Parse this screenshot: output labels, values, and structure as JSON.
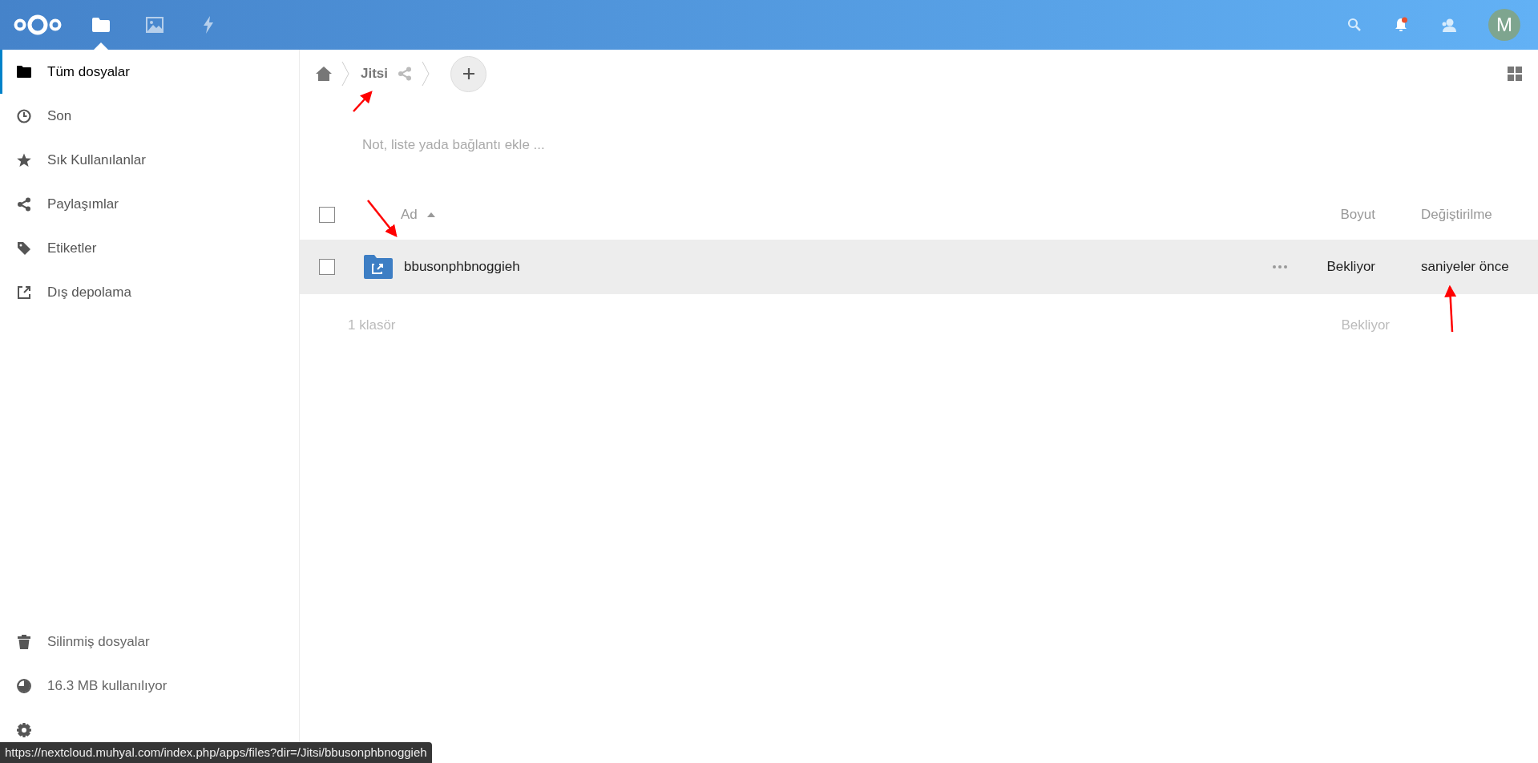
{
  "header": {
    "apps": [
      {
        "kind": "files",
        "selected": true
      },
      {
        "kind": "gallery",
        "selected": false
      },
      {
        "kind": "activity",
        "selected": false
      }
    ],
    "notifications_unread": true,
    "avatar": "M"
  },
  "sidebar": {
    "items": [
      {
        "kind": "folder",
        "label": "Tüm dosyalar",
        "selected": true
      },
      {
        "kind": "clock",
        "label": "Son",
        "selected": false
      },
      {
        "kind": "star",
        "label": "Sık Kullanılanlar",
        "selected": false
      },
      {
        "kind": "share",
        "label": "Paylaşımlar",
        "selected": false
      },
      {
        "kind": "tag",
        "label": "Etiketler",
        "selected": false
      },
      {
        "kind": "external",
        "label": "Dış depolama",
        "selected": false
      }
    ],
    "bottom_items": [
      {
        "kind": "trash",
        "label": "Silinmiş dosyalar"
      },
      {
        "kind": "quota",
        "label": "16.3 MB kullanılıyor"
      },
      {
        "kind": "settings"
      }
    ]
  },
  "breadcrumb": {
    "folder": "Jitsi"
  },
  "note": {
    "placeholder": "Not, liste yada bağlantı ekle ..."
  },
  "table": {
    "select_all": {
      "checked": false
    },
    "columns": [
      "Ad",
      "Boyut",
      "Değiştirilme"
    ],
    "rows": [
      {
        "name": "bbusonphbnoggieh",
        "size": "Bekliyor",
        "modified": "saniyeler önce",
        "checked": false,
        "highlighted": true
      }
    ],
    "footer": {
      "summary": "1 klasör",
      "size": "Bekliyor"
    }
  },
  "status_url": "https://nextcloud.muhyal.com/index.php/apps/files?dir=/Jitsi/bbusonphbnoggieh"
}
